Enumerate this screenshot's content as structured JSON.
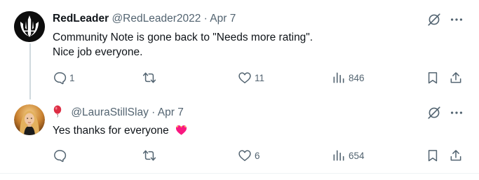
{
  "tweets": [
    {
      "display_name": "RedLeader",
      "handle": "@RedLeader2022",
      "separator": "·",
      "date": "Apr 7",
      "text_lines": [
        "Community Note is gone back to \"Needs more rating\".",
        "Nice job everyone."
      ],
      "replies": "1",
      "retweets": "",
      "likes": "11",
      "views": "846",
      "avatar_icon": "jedi-order-emblem"
    },
    {
      "display_name_emoji": "red-balloon-icon",
      "handle": "@LauraStillSlay",
      "separator": "·",
      "date": "Apr 7",
      "text": "Yes thanks for everyone",
      "text_emoji": "heart-with-ribbon-icon",
      "replies": "",
      "retweets": "",
      "likes": "6",
      "views": "654",
      "avatar_icon": "user-photo"
    }
  ],
  "colors": {
    "text": "#0f1419",
    "muted": "#536471",
    "thread_line": "#cfd9de",
    "heart": "#f91880",
    "balloon": "#dd2e44"
  }
}
